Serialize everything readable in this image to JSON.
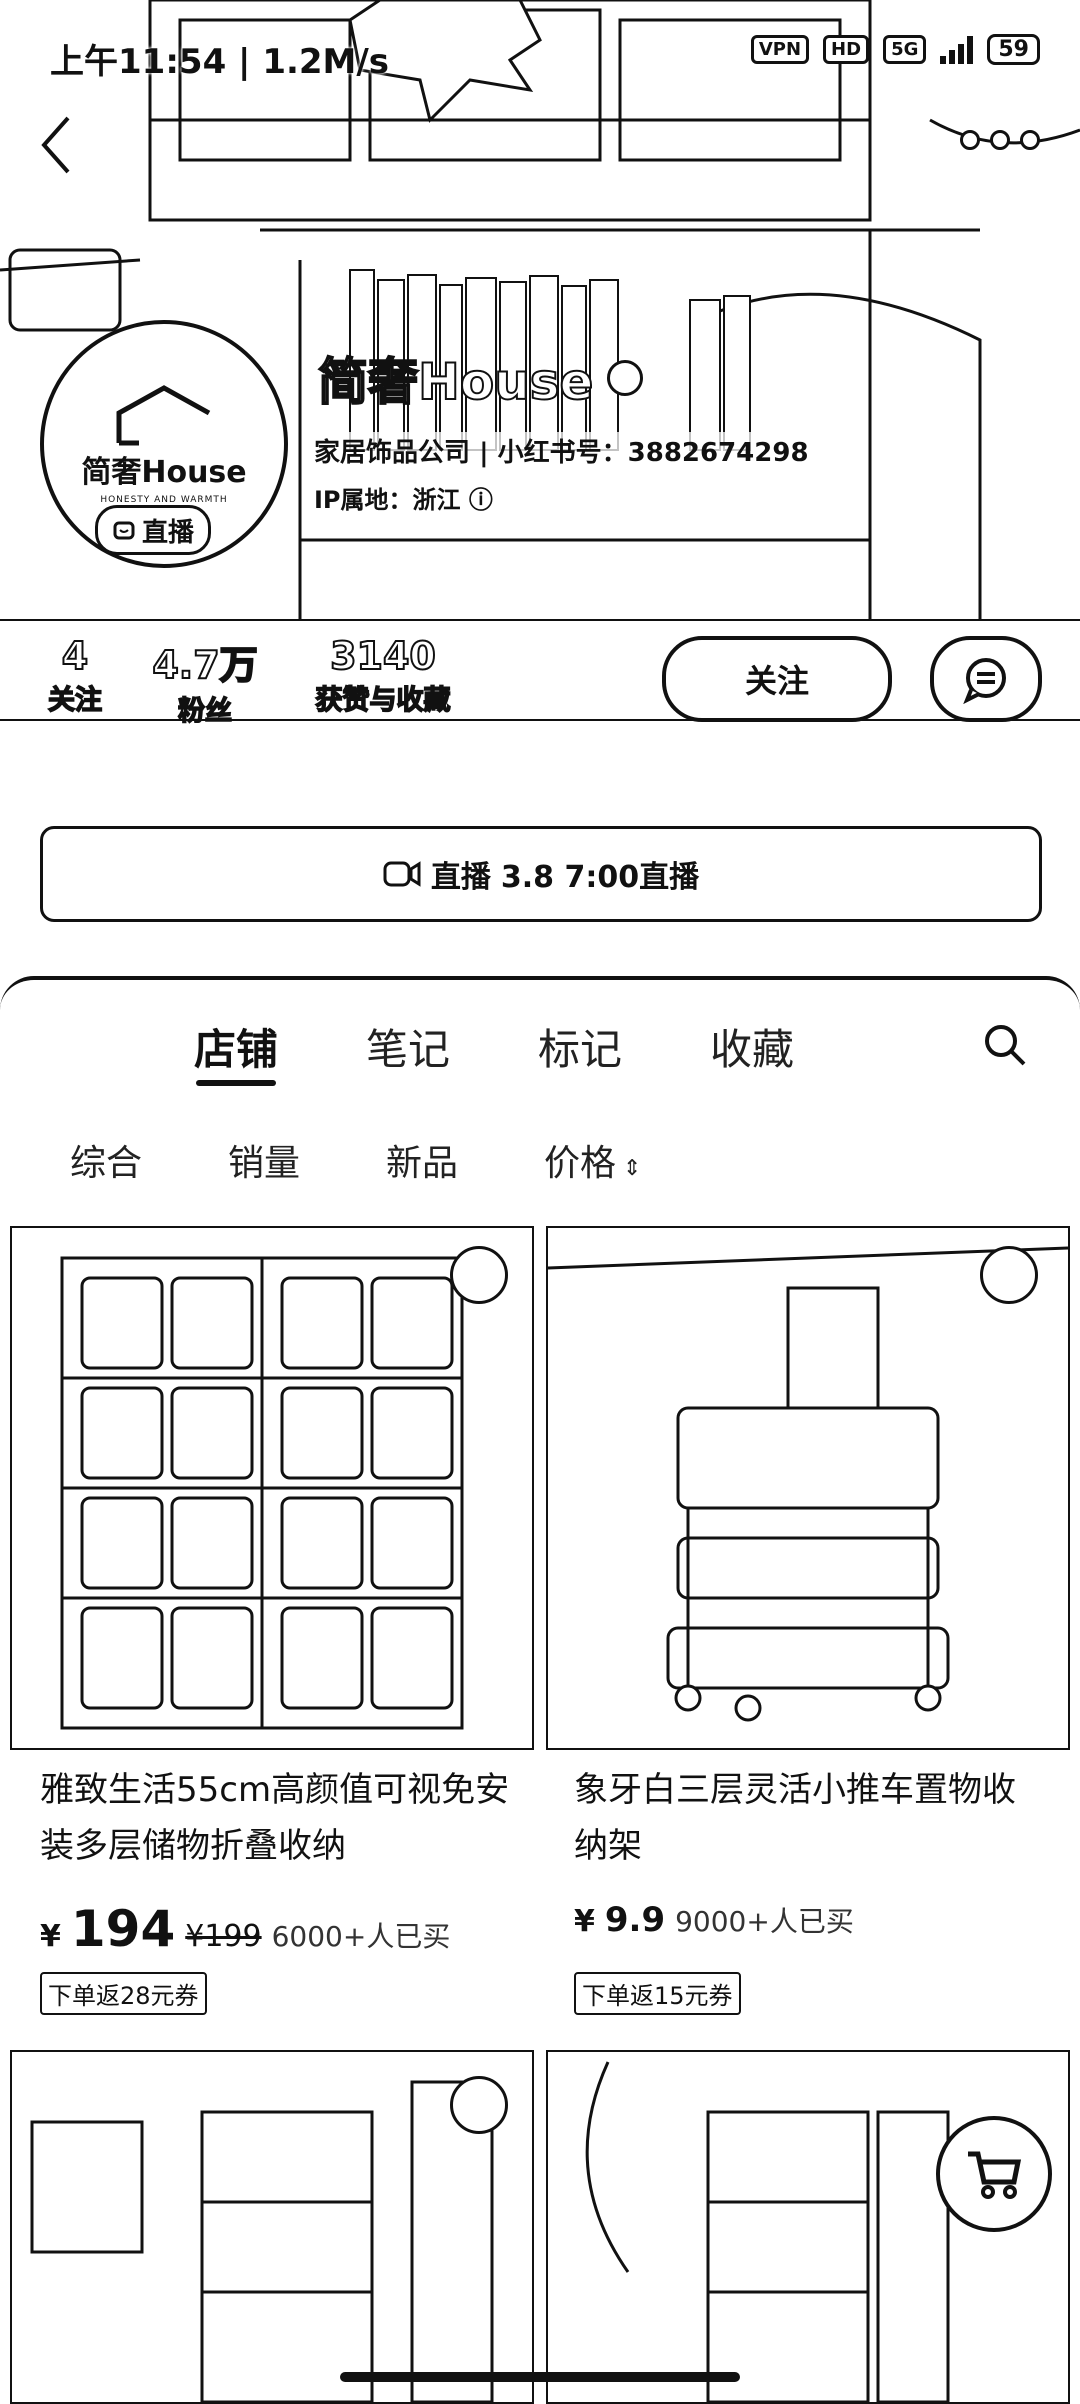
{
  "status_bar": {
    "time_speed": "上午11:54 | 1.2M/s",
    "vpn": "VPN",
    "hd": "HD",
    "network": "5G",
    "battery": "59"
  },
  "profile": {
    "avatar_text": "简奢House",
    "avatar_sub": "HONESTY AND WARMTH",
    "live_badge": "直播",
    "name": "简奢House",
    "company": "家居饰品公司",
    "redbook_id": "小红书号：3882674298",
    "ip": "IP属地：浙江",
    "stats": [
      {
        "num": "4",
        "label": "关注"
      },
      {
        "num": "4.7万",
        "label": "粉丝"
      },
      {
        "num": "3140",
        "label": "获赞与收藏"
      }
    ],
    "follow_label": "关注"
  },
  "live_bar": {
    "label": "直播",
    "time": "3.8 7:00直播"
  },
  "tabs": [
    {
      "label": "店铺",
      "active": true
    },
    {
      "label": "笔记",
      "active": false
    },
    {
      "label": "标记",
      "active": false
    },
    {
      "label": "收藏",
      "active": false
    }
  ],
  "sorts": [
    "综合",
    "销量",
    "新品",
    "价格"
  ],
  "products": [
    {
      "title": "雅致生活55cm高颜值可视免安装多层储物折叠收纳",
      "price": "194",
      "orig_price": "¥199",
      "sold": "6000+人已买",
      "coupon": "下单返28元券"
    },
    {
      "title": "象牙白三层灵活小推车置物收纳架",
      "price": "9.9",
      "orig_price": "",
      "sold": "9000+人已买",
      "coupon": "下单返15元券"
    }
  ],
  "yen": "¥"
}
